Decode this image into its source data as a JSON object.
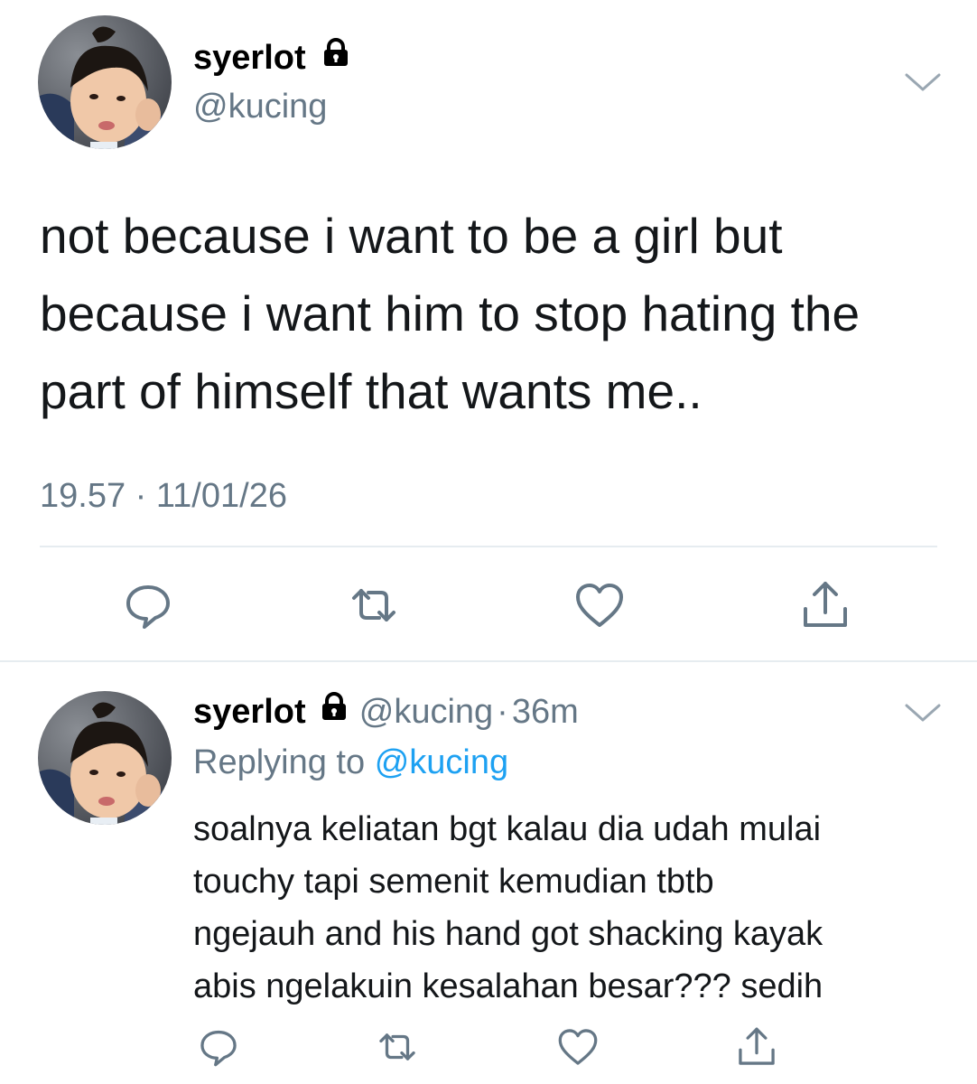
{
  "main_tweet": {
    "author": {
      "display_name": "syerlot",
      "handle": "@kucing",
      "avatar": "avatar-photo",
      "protected_icon": "lock-icon"
    },
    "text_lines": [
      "not because i want to be a girl but",
      "because i want him to stop hating the",
      "part of himself that wants me.."
    ],
    "timestamp": "19.57 · 11/01/26",
    "menu_icon": "chevron-down-icon",
    "actions": [
      "reply-icon",
      "retweet-icon",
      "like-icon",
      "share-icon"
    ]
  },
  "reply_tweet": {
    "author": {
      "display_name": "syerlot",
      "handle": "@kucing",
      "avatar": "avatar-photo",
      "protected_icon": "lock-icon"
    },
    "separator": "·",
    "time_ago": "36m",
    "replying_to_label": "Replying to",
    "replying_to_handle": "@kucing",
    "text_lines": [
      "soalnya keliatan bgt kalau dia udah mulai",
      "touchy tapi semenit kemudian tbtb",
      "ngejauh and his hand got shacking kayak",
      "abis ngelakuin kesalahan besar??? sedih"
    ],
    "menu_icon": "chevron-down-icon",
    "actions": [
      "reply-icon",
      "retweet-icon",
      "like-icon",
      "share-icon"
    ]
  },
  "colors": {
    "text": "#14171a",
    "muted": "#657786",
    "link": "#1da1f2",
    "divider": "#e6ecf0"
  }
}
